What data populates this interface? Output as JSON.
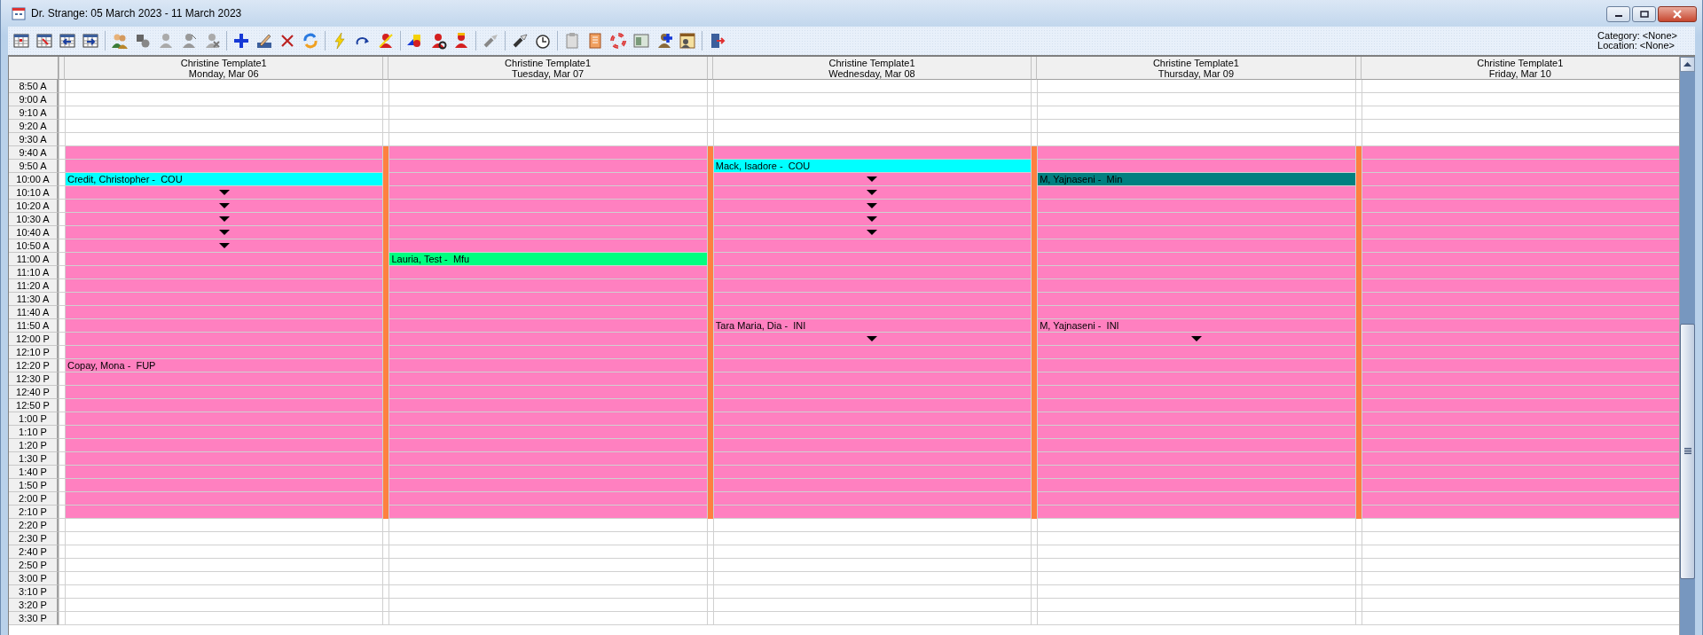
{
  "window": {
    "title": "Dr. Strange: 05 March 2023 - 11 March 2023"
  },
  "filters": [
    {
      "text": "Category: <None>"
    },
    {
      "text": "Location: <None>"
    }
  ],
  "days": [
    {
      "title": "Christine Template1",
      "date": "Monday, Mar 06",
      "flagged": false
    },
    {
      "title": "Christine Template1",
      "date": "Tuesday, Mar 07",
      "flagged": true
    },
    {
      "title": "Christine Template1",
      "date": "Wednesday, Mar 08",
      "flagged": true
    },
    {
      "title": "Christine Template1",
      "date": "Thursday, Mar 09",
      "flagged": true
    },
    {
      "title": "Christine Template1",
      "date": "Friday, Mar 10",
      "flagged": true
    }
  ],
  "rows": [
    {
      "time": "8:50 A",
      "scheduled": false,
      "cells": [
        {
          "kind": "empty"
        },
        {
          "kind": "empty"
        },
        {
          "kind": "empty"
        },
        {
          "kind": "empty"
        },
        {
          "kind": "empty"
        }
      ]
    },
    {
      "time": "9:00 A",
      "scheduled": false,
      "cells": [
        {
          "kind": "empty"
        },
        {
          "kind": "empty"
        },
        {
          "kind": "empty"
        },
        {
          "kind": "empty"
        },
        {
          "kind": "empty"
        }
      ]
    },
    {
      "time": "9:10 A",
      "scheduled": false,
      "cells": [
        {
          "kind": "empty"
        },
        {
          "kind": "empty"
        },
        {
          "kind": "empty"
        },
        {
          "kind": "empty"
        },
        {
          "kind": "empty"
        }
      ]
    },
    {
      "time": "9:20 A",
      "scheduled": false,
      "cells": [
        {
          "kind": "empty"
        },
        {
          "kind": "empty"
        },
        {
          "kind": "empty"
        },
        {
          "kind": "empty"
        },
        {
          "kind": "empty"
        }
      ]
    },
    {
      "time": "9:30 A",
      "scheduled": false,
      "cells": [
        {
          "kind": "empty"
        },
        {
          "kind": "empty"
        },
        {
          "kind": "empty"
        },
        {
          "kind": "empty"
        },
        {
          "kind": "empty"
        }
      ]
    },
    {
      "time": "9:40 A",
      "scheduled": true,
      "cells": [
        {
          "kind": "empty"
        },
        {
          "kind": "empty"
        },
        {
          "kind": "empty"
        },
        {
          "kind": "empty"
        },
        {
          "kind": "empty"
        }
      ]
    },
    {
      "time": "9:50 A",
      "scheduled": true,
      "cells": [
        {
          "kind": "empty"
        },
        {
          "kind": "empty"
        },
        {
          "kind": "appointment",
          "label": "Mack, Isadore -  COU",
          "color": "#00ffff"
        },
        {
          "kind": "empty"
        },
        {
          "kind": "empty"
        }
      ]
    },
    {
      "time": "10:00 A",
      "scheduled": true,
      "cells": [
        {
          "kind": "appointment",
          "label": "Credit, Christopher -  COU",
          "color": "#00ffff"
        },
        {
          "kind": "empty"
        },
        {
          "kind": "continuation"
        },
        {
          "kind": "appointment",
          "label": "M, Yajnaseni -  Min",
          "color": "#008080"
        },
        {
          "kind": "empty"
        }
      ]
    },
    {
      "time": "10:10 A",
      "scheduled": true,
      "cells": [
        {
          "kind": "continuation"
        },
        {
          "kind": "empty"
        },
        {
          "kind": "continuation"
        },
        {
          "kind": "empty"
        },
        {
          "kind": "empty"
        }
      ]
    },
    {
      "time": "10:20 A",
      "scheduled": true,
      "cells": [
        {
          "kind": "continuation"
        },
        {
          "kind": "empty"
        },
        {
          "kind": "continuation"
        },
        {
          "kind": "empty"
        },
        {
          "kind": "empty"
        }
      ]
    },
    {
      "time": "10:30 A",
      "scheduled": true,
      "cells": [
        {
          "kind": "continuation"
        },
        {
          "kind": "empty"
        },
        {
          "kind": "continuation"
        },
        {
          "kind": "empty"
        },
        {
          "kind": "empty"
        }
      ]
    },
    {
      "time": "10:40 A",
      "scheduled": true,
      "cells": [
        {
          "kind": "continuation"
        },
        {
          "kind": "empty"
        },
        {
          "kind": "continuation"
        },
        {
          "kind": "empty"
        },
        {
          "kind": "empty"
        }
      ]
    },
    {
      "time": "10:50 A",
      "scheduled": true,
      "cells": [
        {
          "kind": "continuation"
        },
        {
          "kind": "empty"
        },
        {
          "kind": "empty"
        },
        {
          "kind": "empty"
        },
        {
          "kind": "empty"
        }
      ]
    },
    {
      "time": "11:00 A",
      "scheduled": true,
      "cells": [
        {
          "kind": "empty"
        },
        {
          "kind": "appointment",
          "label": "Lauria, Test -  Mfu",
          "color": "#00ff80"
        },
        {
          "kind": "empty"
        },
        {
          "kind": "empty"
        },
        {
          "kind": "empty"
        }
      ]
    },
    {
      "time": "11:10 A",
      "scheduled": true,
      "cells": [
        {
          "kind": "empty"
        },
        {
          "kind": "empty"
        },
        {
          "kind": "empty"
        },
        {
          "kind": "empty"
        },
        {
          "kind": "empty"
        }
      ]
    },
    {
      "time": "11:20 A",
      "scheduled": true,
      "cells": [
        {
          "kind": "empty"
        },
        {
          "kind": "empty"
        },
        {
          "kind": "empty"
        },
        {
          "kind": "empty"
        },
        {
          "kind": "empty"
        }
      ]
    },
    {
      "time": "11:30 A",
      "scheduled": true,
      "cells": [
        {
          "kind": "empty"
        },
        {
          "kind": "empty"
        },
        {
          "kind": "empty"
        },
        {
          "kind": "empty"
        },
        {
          "kind": "empty"
        }
      ]
    },
    {
      "time": "11:40 A",
      "scheduled": true,
      "cells": [
        {
          "kind": "empty"
        },
        {
          "kind": "empty"
        },
        {
          "kind": "empty"
        },
        {
          "kind": "empty"
        },
        {
          "kind": "empty"
        }
      ]
    },
    {
      "time": "11:50 A",
      "scheduled": true,
      "cells": [
        {
          "kind": "empty"
        },
        {
          "kind": "empty"
        },
        {
          "kind": "appointment",
          "label": "Tara Maria, Dia -  INI"
        },
        {
          "kind": "appointment",
          "label": "M, Yajnaseni -  INI"
        },
        {
          "kind": "empty"
        }
      ]
    },
    {
      "time": "12:00 P",
      "scheduled": true,
      "cells": [
        {
          "kind": "empty"
        },
        {
          "kind": "empty"
        },
        {
          "kind": "continuation"
        },
        {
          "kind": "continuation"
        },
        {
          "kind": "empty"
        }
      ]
    },
    {
      "time": "12:10 P",
      "scheduled": true,
      "cells": [
        {
          "kind": "empty"
        },
        {
          "kind": "empty"
        },
        {
          "kind": "empty"
        },
        {
          "kind": "empty"
        },
        {
          "kind": "empty"
        }
      ]
    },
    {
      "time": "12:20 P",
      "scheduled": true,
      "cells": [
        {
          "kind": "appointment",
          "label": "Copay, Mona -  FUP"
        },
        {
          "kind": "empty"
        },
        {
          "kind": "empty"
        },
        {
          "kind": "empty"
        },
        {
          "kind": "empty"
        }
      ]
    },
    {
      "time": "12:30 P",
      "scheduled": true,
      "cells": [
        {
          "kind": "empty"
        },
        {
          "kind": "empty"
        },
        {
          "kind": "empty"
        },
        {
          "kind": "empty"
        },
        {
          "kind": "empty"
        }
      ]
    },
    {
      "time": "12:40 P",
      "scheduled": true,
      "cells": [
        {
          "kind": "empty"
        },
        {
          "kind": "empty"
        },
        {
          "kind": "empty"
        },
        {
          "kind": "empty"
        },
        {
          "kind": "empty"
        }
      ]
    },
    {
      "time": "12:50 P",
      "scheduled": true,
      "cells": [
        {
          "kind": "empty"
        },
        {
          "kind": "empty"
        },
        {
          "kind": "empty"
        },
        {
          "kind": "empty"
        },
        {
          "kind": "empty"
        }
      ]
    },
    {
      "time": "1:00 P",
      "scheduled": true,
      "cells": [
        {
          "kind": "empty"
        },
        {
          "kind": "empty"
        },
        {
          "kind": "empty"
        },
        {
          "kind": "empty"
        },
        {
          "kind": "empty"
        }
      ]
    },
    {
      "time": "1:10 P",
      "scheduled": true,
      "cells": [
        {
          "kind": "empty"
        },
        {
          "kind": "empty"
        },
        {
          "kind": "empty"
        },
        {
          "kind": "empty"
        },
        {
          "kind": "empty"
        }
      ]
    },
    {
      "time": "1:20 P",
      "scheduled": true,
      "cells": [
        {
          "kind": "empty"
        },
        {
          "kind": "empty"
        },
        {
          "kind": "empty"
        },
        {
          "kind": "empty"
        },
        {
          "kind": "empty"
        }
      ]
    },
    {
      "time": "1:30 P",
      "scheduled": true,
      "cells": [
        {
          "kind": "empty"
        },
        {
          "kind": "empty"
        },
        {
          "kind": "empty"
        },
        {
          "kind": "empty"
        },
        {
          "kind": "empty"
        }
      ]
    },
    {
      "time": "1:40 P",
      "scheduled": true,
      "cells": [
        {
          "kind": "empty"
        },
        {
          "kind": "empty"
        },
        {
          "kind": "empty"
        },
        {
          "kind": "empty"
        },
        {
          "kind": "empty"
        }
      ]
    },
    {
      "time": "1:50 P",
      "scheduled": true,
      "cells": [
        {
          "kind": "empty"
        },
        {
          "kind": "empty"
        },
        {
          "kind": "empty"
        },
        {
          "kind": "empty"
        },
        {
          "kind": "empty"
        }
      ]
    },
    {
      "time": "2:00 P",
      "scheduled": true,
      "cells": [
        {
          "kind": "empty"
        },
        {
          "kind": "empty"
        },
        {
          "kind": "empty"
        },
        {
          "kind": "empty"
        },
        {
          "kind": "empty"
        }
      ]
    },
    {
      "time": "2:10 P",
      "scheduled": true,
      "cells": [
        {
          "kind": "empty"
        },
        {
          "kind": "empty"
        },
        {
          "kind": "empty"
        },
        {
          "kind": "empty"
        },
        {
          "kind": "empty"
        }
      ]
    },
    {
      "time": "2:20 P",
      "scheduled": false,
      "cells": [
        {
          "kind": "empty"
        },
        {
          "kind": "empty"
        },
        {
          "kind": "empty"
        },
        {
          "kind": "empty"
        },
        {
          "kind": "empty"
        }
      ]
    },
    {
      "time": "2:30 P",
      "scheduled": false,
      "cells": [
        {
          "kind": "empty"
        },
        {
          "kind": "empty"
        },
        {
          "kind": "empty"
        },
        {
          "kind": "empty"
        },
        {
          "kind": "empty"
        }
      ]
    },
    {
      "time": "2:40 P",
      "scheduled": false,
      "cells": [
        {
          "kind": "empty"
        },
        {
          "kind": "empty"
        },
        {
          "kind": "empty"
        },
        {
          "kind": "empty"
        },
        {
          "kind": "empty"
        }
      ]
    },
    {
      "time": "2:50 P",
      "scheduled": false,
      "cells": [
        {
          "kind": "empty"
        },
        {
          "kind": "empty"
        },
        {
          "kind": "empty"
        },
        {
          "kind": "empty"
        },
        {
          "kind": "empty"
        }
      ]
    },
    {
      "time": "3:00 P",
      "scheduled": false,
      "cells": [
        {
          "kind": "empty"
        },
        {
          "kind": "empty"
        },
        {
          "kind": "empty"
        },
        {
          "kind": "empty"
        },
        {
          "kind": "empty"
        }
      ]
    },
    {
      "time": "3:10 P",
      "scheduled": false,
      "cells": [
        {
          "kind": "empty"
        },
        {
          "kind": "empty"
        },
        {
          "kind": "empty"
        },
        {
          "kind": "empty"
        },
        {
          "kind": "empty"
        }
      ]
    },
    {
      "time": "3:20 P",
      "scheduled": false,
      "cells": [
        {
          "kind": "empty"
        },
        {
          "kind": "empty"
        },
        {
          "kind": "empty"
        },
        {
          "kind": "empty"
        },
        {
          "kind": "empty"
        }
      ]
    },
    {
      "time": "3:30 P",
      "scheduled": false,
      "cells": [
        {
          "kind": "empty"
        },
        {
          "kind": "empty"
        },
        {
          "kind": "empty"
        },
        {
          "kind": "empty"
        },
        {
          "kind": "empty"
        }
      ]
    }
  ]
}
